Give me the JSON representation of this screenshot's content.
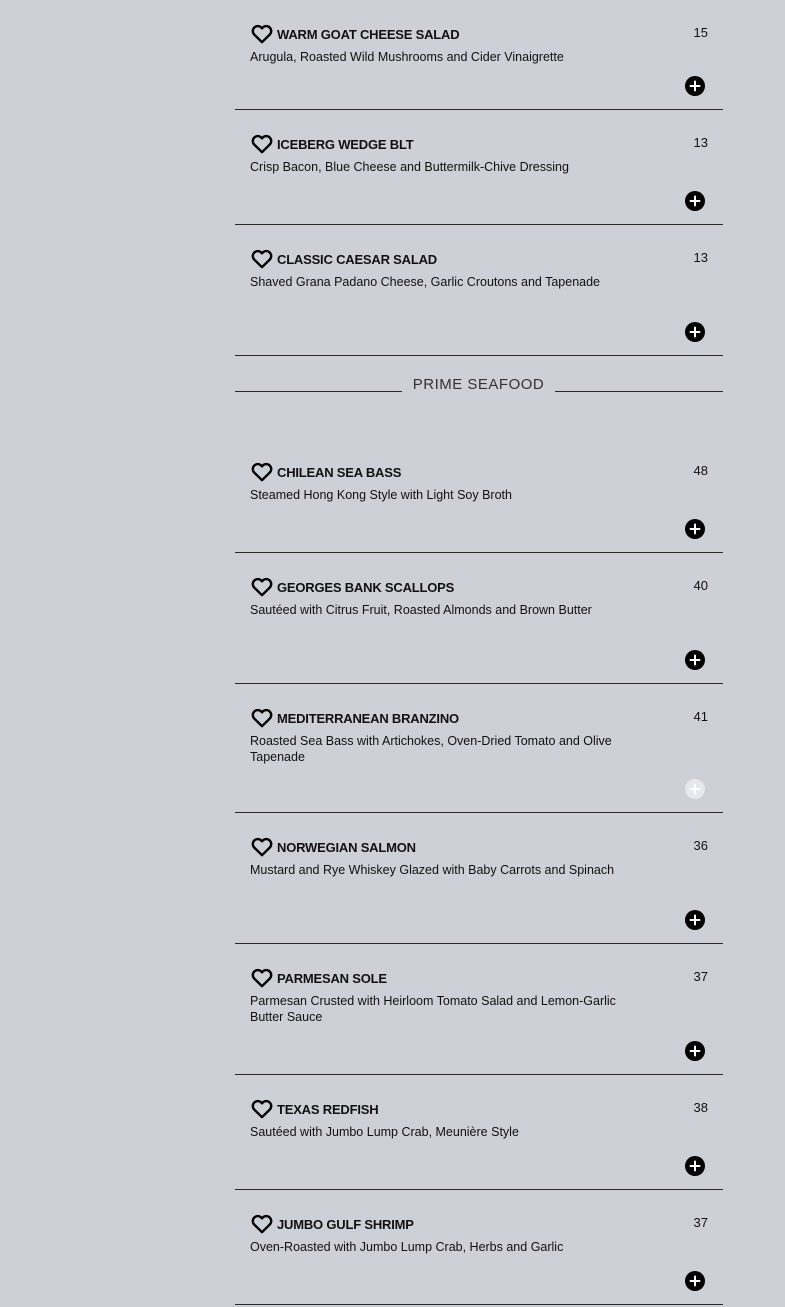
{
  "salads": [
    {
      "name": "WARM GOAT CHEESE SALAD",
      "price": "15",
      "description": "Arugula, Roasted Wild Mushrooms and Cider Vinaigrette",
      "add_enabled": true
    },
    {
      "name": "ICEBERG WEDGE BLT",
      "price": "13",
      "description": "Crisp Bacon, Blue Cheese and Buttermilk-Chive Dressing",
      "add_enabled": true
    },
    {
      "name": "CLASSIC CAESAR SALAD",
      "price": "13",
      "description": "Shaved Grana Padano Cheese, Garlic Croutons and Tapenade",
      "add_enabled": true
    }
  ],
  "seafood_section": {
    "title": "PRIME SEAFOOD"
  },
  "seafood": [
    {
      "name": "CHILEAN SEA BASS",
      "price": "48",
      "description": "Steamed Hong Kong Style with Light Soy Broth",
      "add_enabled": true
    },
    {
      "name": "GEORGES BANK SCALLOPS",
      "price": "40",
      "description": "Sautéed with Citrus Fruit, Roasted Almonds and Brown Butter",
      "add_enabled": true
    },
    {
      "name": "MEDITERRANEAN BRANZINO",
      "price": "41",
      "description": "Roasted Sea Bass with Artichokes, Oven-Dried Tomato and Olive Tapenade",
      "add_enabled": false
    },
    {
      "name": "NORWEGIAN SALMON",
      "price": "36",
      "description": "Mustard and Rye Whiskey Glazed with Baby Carrots and Spinach",
      "add_enabled": true
    },
    {
      "name": "PARMESAN SOLE",
      "price": "37",
      "description": "Parmesan Crusted with Heirloom Tomato Salad and Lemon-Garlic Butter Sauce",
      "add_enabled": true
    },
    {
      "name": "TEXAS REDFISH",
      "price": "38",
      "description": "Sautéed with Jumbo Lump Crab, Meunière Style",
      "add_enabled": true
    },
    {
      "name": "JUMBO GULF SHRIMP",
      "price": "37",
      "description": "Oven-Roasted with Jumbo Lump Crab, Herbs and Garlic",
      "add_enabled": true
    }
  ],
  "icons": {
    "favorite": "heart-outline-icon",
    "add": "plus-circle-icon"
  },
  "colors": {
    "background": "#cdd0d6",
    "add_enabled": "#000000",
    "add_disabled": "#e6e8eb"
  }
}
